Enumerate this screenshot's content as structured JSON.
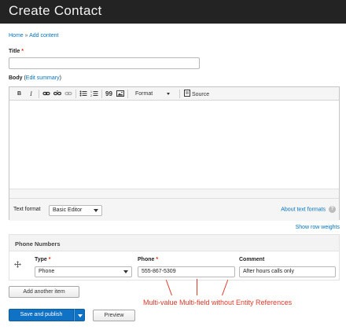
{
  "header": {
    "title": "Create Contact"
  },
  "breadcrumb": {
    "home": "Home",
    "sep": "»",
    "current": "Add content"
  },
  "title_field": {
    "label": "Title",
    "required": "*",
    "value": ""
  },
  "body_field": {
    "label": "Body",
    "edit_summary_open": "(",
    "edit_summary": "Edit summary",
    "edit_summary_close": ")"
  },
  "toolbar": {
    "bold": "B",
    "italic": "I",
    "blockquote": "99",
    "format_label": "Format",
    "source_label": "Source"
  },
  "text_format": {
    "label": "Text format",
    "value": "Basic Editor",
    "about_link": "About text formats",
    "help": "?"
  },
  "show_row_weights": "Show row weights",
  "phone_numbers": {
    "heading": "Phone Numbers",
    "columns": {
      "type": "Type",
      "phone": "Phone",
      "comment": "Comment"
    },
    "required": "*",
    "row": {
      "type": "Phone",
      "phone": "555-867-5309",
      "comment": "After hours calls only"
    }
  },
  "add_another_item": "Add another item",
  "annotation": {
    "text": "Multi-value Multi-field without Entity References",
    "color": "#e2382b"
  },
  "actions": {
    "save_publish": "Save and publish",
    "preview": "Preview"
  },
  "colors": {
    "header_bg": "#232323",
    "link": "#0074bd",
    "primary_button": "#0f72c4",
    "required": "#e32700"
  }
}
